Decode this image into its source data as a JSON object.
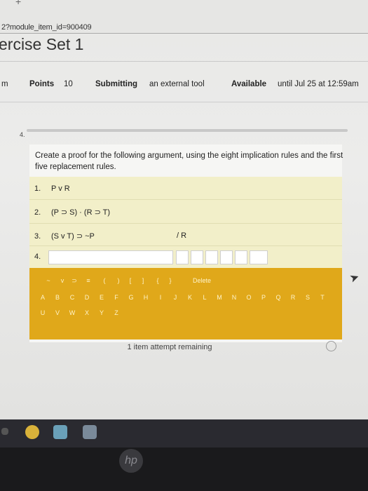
{
  "browser": {
    "new_tab": "+",
    "url": "2?module_item_id=900409"
  },
  "page": {
    "title": "ercise Set 1"
  },
  "meta": {
    "left_fragment": "m",
    "points_label": "Points",
    "points_value": "10",
    "submitting_label": "Submitting",
    "submitting_value": "an external tool",
    "available_label": "Available",
    "available_value": "until Jul 25 at 12:59am"
  },
  "question": {
    "number": "4.",
    "prompt": "Create a proof for the following argument, using the eight implication rules and the first five replacement rules.",
    "lines": [
      {
        "num": "1.",
        "formula": "P v R"
      },
      {
        "num": "2.",
        "formula": "(P ⊃ S) · (R ⊃ T)"
      },
      {
        "num": "3.",
        "formula": "(S v T) ⊃ ~P"
      }
    ],
    "conclusion": "/ R",
    "input_line_num": "4."
  },
  "keypad": {
    "symbols": [
      "~",
      "v",
      "⊃",
      "≡",
      "(",
      ")",
      "[",
      "]",
      "{",
      "}",
      "Delete"
    ],
    "letters_row1": [
      "A",
      "B",
      "C",
      "D",
      "E",
      "F",
      "G",
      "H",
      "I",
      "J",
      "K",
      "L",
      "M",
      "N",
      "O",
      "P",
      "Q",
      "R",
      "S",
      "T"
    ],
    "letters_row2": [
      "U",
      "V",
      "W",
      "X",
      "Y",
      "Z"
    ]
  },
  "footer": {
    "attempts": "1 item attempt remaining"
  },
  "colors": {
    "keypad": "#e0a81a",
    "proof_area": "#f2efc9"
  }
}
